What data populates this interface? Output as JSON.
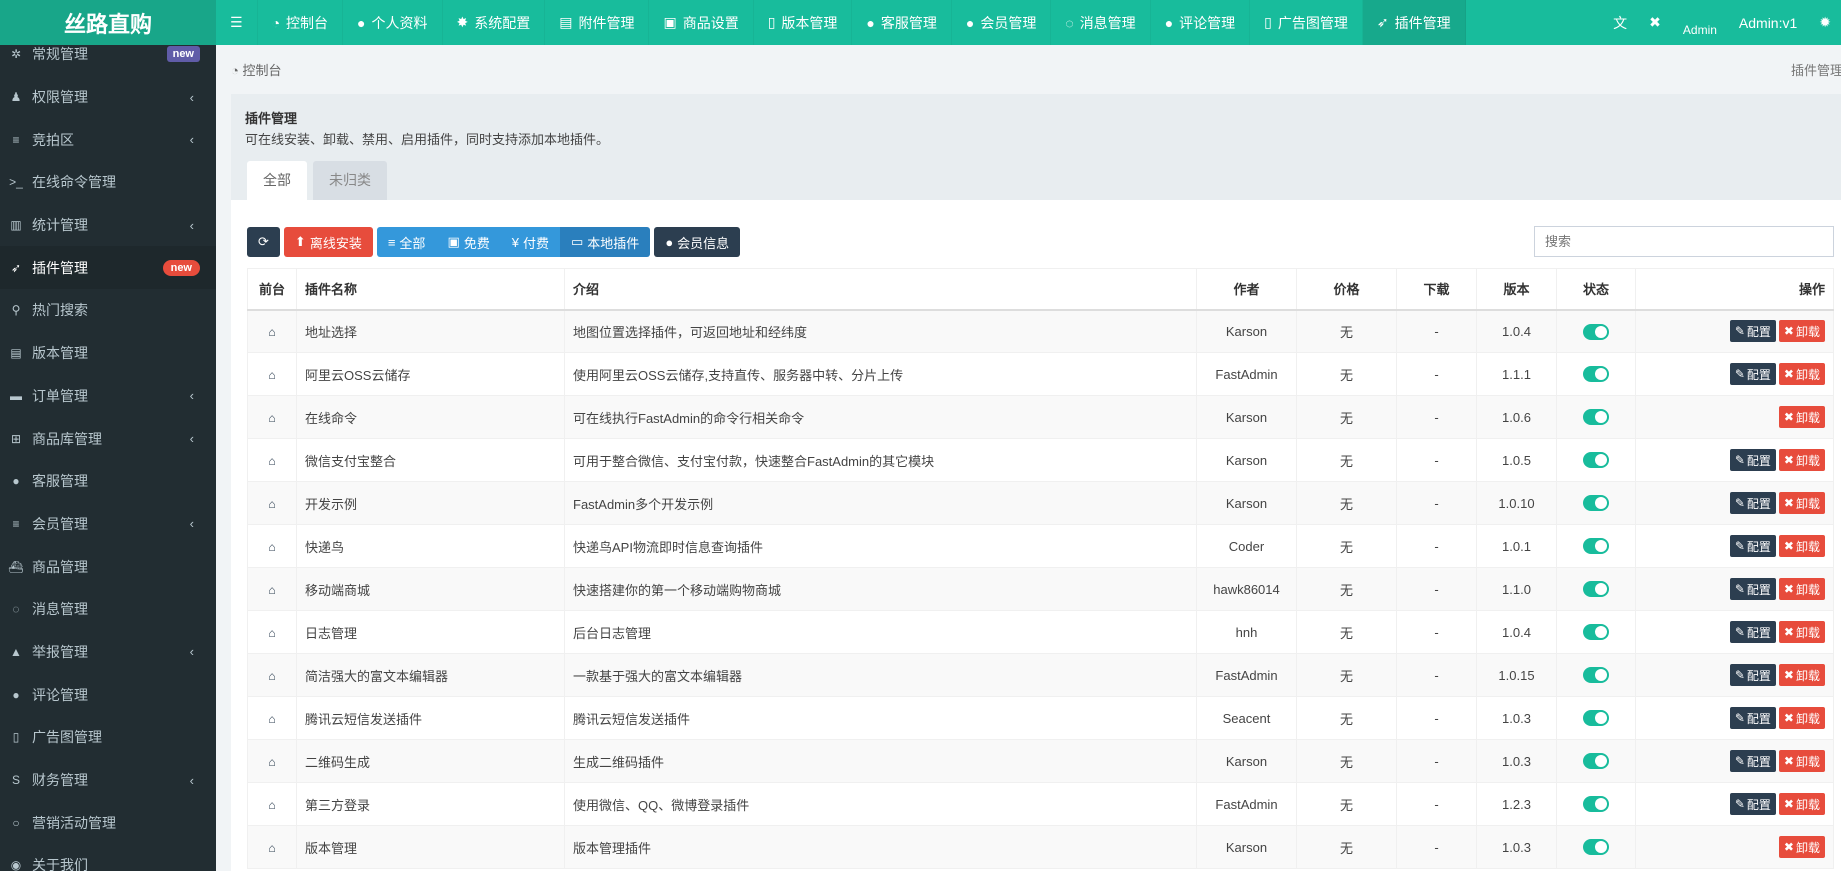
{
  "app": {
    "logo": "丝路直购",
    "admin_name": "Admin:v1",
    "avatar_alt": "Admin"
  },
  "topnav": [
    {
      "icon": "dashboard-icon",
      "glyph": "◔",
      "label": "控制台"
    },
    {
      "icon": "user-icon",
      "glyph": "●",
      "label": "个人资料"
    },
    {
      "icon": "gear-icon",
      "glyph": "✸",
      "label": "系统配置"
    },
    {
      "icon": "file-image-icon",
      "glyph": "▤",
      "label": "附件管理"
    },
    {
      "icon": "gift-icon",
      "glyph": "▣",
      "label": "商品设置"
    },
    {
      "icon": "file-text-icon",
      "glyph": "▯",
      "label": "版本管理"
    },
    {
      "icon": "user-icon",
      "glyph": "●",
      "label": "客服管理"
    },
    {
      "icon": "user-icon",
      "glyph": "●",
      "label": "会员管理"
    },
    {
      "icon": "comments-icon",
      "glyph": "◌",
      "label": "消息管理"
    },
    {
      "icon": "comment-icon",
      "glyph": "●",
      "label": "评论管理"
    },
    {
      "icon": "file-icon",
      "glyph": "▯",
      "label": "广告图管理"
    },
    {
      "icon": "rocket-icon",
      "glyph": "➶",
      "label": "插件管理",
      "active": true
    }
  ],
  "sidebar": [
    {
      "icon": "cogs-icon",
      "glyph": "✲",
      "label": "常规管理",
      "badge": "new",
      "badge_color": "#605ca8"
    },
    {
      "icon": "users-icon",
      "glyph": "♟",
      "label": "权限管理",
      "chevron": true
    },
    {
      "icon": "list-icon",
      "glyph": "≡",
      "label": "竞拍区",
      "chevron": true
    },
    {
      "icon": "terminal-icon",
      "glyph": ">_",
      "label": "在线命令管理"
    },
    {
      "icon": "bar-chart-icon",
      "glyph": "▥",
      "label": "统计管理",
      "chevron": true
    },
    {
      "icon": "rocket-icon",
      "glyph": "➶",
      "label": "插件管理",
      "badge": "new",
      "badge_color": "#e74c3c",
      "active": true
    },
    {
      "icon": "search-icon",
      "glyph": "⚲",
      "label": "热门搜索"
    },
    {
      "icon": "file-text-icon",
      "glyph": "▤",
      "label": "版本管理"
    },
    {
      "icon": "credit-card-icon",
      "glyph": "▬",
      "label": "订单管理",
      "chevron": true
    },
    {
      "icon": "shopping-basket-icon",
      "glyph": "⊞",
      "label": "商品库管理",
      "chevron": true
    },
    {
      "icon": "user-icon",
      "glyph": "●",
      "label": "客服管理"
    },
    {
      "icon": "list-icon",
      "glyph": "≡",
      "label": "会员管理",
      "chevron": true
    },
    {
      "icon": "ship-icon",
      "glyph": "⛴",
      "label": "商品管理"
    },
    {
      "icon": "comments-icon",
      "glyph": "◌",
      "label": "消息管理"
    },
    {
      "icon": "warning-icon",
      "glyph": "▲",
      "label": "举报管理",
      "chevron": true
    },
    {
      "icon": "comment-icon",
      "glyph": "●",
      "label": "评论管理"
    },
    {
      "icon": "file-icon",
      "glyph": "▯",
      "label": "广告图管理"
    },
    {
      "icon": "strikethrough-icon",
      "glyph": "S",
      "label": "财务管理",
      "chevron": true
    },
    {
      "icon": "circle-icon",
      "glyph": "○",
      "label": "营销活动管理"
    },
    {
      "icon": "user-circle-icon",
      "glyph": "◉",
      "label": "关于我们"
    }
  ],
  "breadcrumb": {
    "home": "控制台",
    "current": "插件管理"
  },
  "panel": {
    "title": "插件管理",
    "desc": "可在线安装、卸载、禁用、启用插件，同时支持添加本地插件。",
    "tabs": [
      "全部",
      "未归类"
    ]
  },
  "toolbar": {
    "offline_install": "离线安装",
    "all": "全部",
    "free": "免费",
    "paid": "付费",
    "local": "本地插件",
    "member_info": "会员信息",
    "search_placeholder": "搜索"
  },
  "table": {
    "headers": [
      "前台",
      "插件名称",
      "介绍",
      "作者",
      "价格",
      "下载",
      "版本",
      "状态",
      "操作"
    ],
    "config_label": "配置",
    "uninstall_label": "卸载",
    "rows": [
      {
        "name": "地址选择",
        "intro": "地图位置选择插件，可返回地址和经纬度",
        "author": "Karson",
        "price": "无",
        "downloads": "-",
        "version": "1.0.4",
        "enabled": true,
        "config": true
      },
      {
        "name": "阿里云OSS云储存",
        "intro": "使用阿里云OSS云储存,支持直传、服务器中转、分片上传",
        "author": "FastAdmin",
        "price": "无",
        "downloads": "-",
        "version": "1.1.1",
        "enabled": true,
        "config": true
      },
      {
        "name": "在线命令",
        "intro": "可在线执行FastAdmin的命令行相关命令",
        "author": "Karson",
        "price": "无",
        "downloads": "-",
        "version": "1.0.6",
        "enabled": true,
        "config": false
      },
      {
        "name": "微信支付宝整合",
        "intro": "可用于整合微信、支付宝付款，快速整合FastAdmin的其它模块",
        "author": "Karson",
        "price": "无",
        "downloads": "-",
        "version": "1.0.5",
        "enabled": true,
        "config": true
      },
      {
        "name": "开发示例",
        "intro": "FastAdmin多个开发示例",
        "author": "Karson",
        "price": "无",
        "downloads": "-",
        "version": "1.0.10",
        "enabled": true,
        "config": true
      },
      {
        "name": "快递鸟",
        "intro": "快递鸟API物流即时信息查询插件",
        "author": "Coder",
        "price": "无",
        "downloads": "-",
        "version": "1.0.1",
        "enabled": true,
        "config": true
      },
      {
        "name": "移动端商城",
        "intro": "快速搭建你的第一个移动端购物商城",
        "author": "hawk86014",
        "price": "无",
        "downloads": "-",
        "version": "1.1.0",
        "enabled": true,
        "config": true
      },
      {
        "name": "日志管理",
        "intro": "后台日志管理",
        "author": "hnh",
        "price": "无",
        "downloads": "-",
        "version": "1.0.4",
        "enabled": true,
        "config": true
      },
      {
        "name": "简洁强大的富文本编辑器",
        "intro": "一款基于强大的富文本编辑器",
        "author": "FastAdmin",
        "price": "无",
        "downloads": "-",
        "version": "1.0.15",
        "enabled": true,
        "config": true
      },
      {
        "name": "腾讯云短信发送插件",
        "intro": "腾讯云短信发送插件",
        "author": "Seacent",
        "price": "无",
        "downloads": "-",
        "version": "1.0.3",
        "enabled": true,
        "config": true
      },
      {
        "name": "二维码生成",
        "intro": "生成二维码插件",
        "author": "Karson",
        "price": "无",
        "downloads": "-",
        "version": "1.0.3",
        "enabled": true,
        "config": true
      },
      {
        "name": "第三方登录",
        "intro": "使用微信、QQ、微博登录插件",
        "author": "FastAdmin",
        "price": "无",
        "downloads": "-",
        "version": "1.2.3",
        "enabled": true,
        "config": true
      },
      {
        "name": "版本管理",
        "intro": "版本管理插件",
        "author": "Karson",
        "price": "无",
        "downloads": "-",
        "version": "1.0.3",
        "enabled": true,
        "config": false
      }
    ]
  }
}
